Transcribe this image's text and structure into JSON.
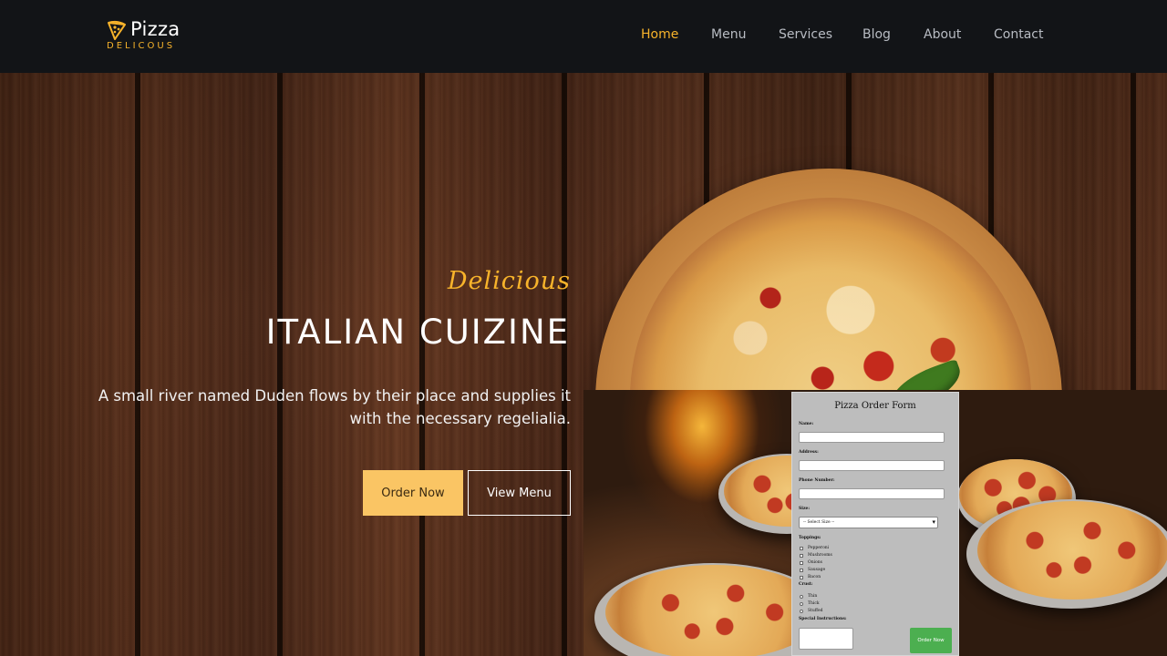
{
  "brand": {
    "name": "Pizza",
    "sub": "DELICOUS"
  },
  "nav": {
    "items": [
      "Home",
      "Menu",
      "Services",
      "Blog",
      "About",
      "Contact"
    ],
    "active": "Home"
  },
  "hero": {
    "eyebrow": "Delicious",
    "title": "ITALIAN CUIZINE",
    "lede": "A small river named Duden flows by their place and supplies it with the necessary regelialia.",
    "order_button": "Order Now",
    "menu_button": "View Menu"
  },
  "order_form": {
    "title": "Pizza Order Form",
    "name_label": "Name:",
    "address_label": "Address:",
    "phone_label": "Phone Number:",
    "size_label": "Size:",
    "size_selected": "-- Select Size --",
    "toppings_label": "Toppings:",
    "toppings": [
      "Pepperoni",
      "Mushrooms",
      "Onions",
      "Sausage",
      "Bacon"
    ],
    "crust_label": "Crust:",
    "crusts": [
      "Thin",
      "Thick",
      "Stuffed"
    ],
    "instructions_label": "Special Instructions:",
    "submit_label": "Order Now"
  },
  "colors": {
    "accent": "#f7b32b",
    "order_button": "#fac564",
    "submit": "#4caf50"
  }
}
